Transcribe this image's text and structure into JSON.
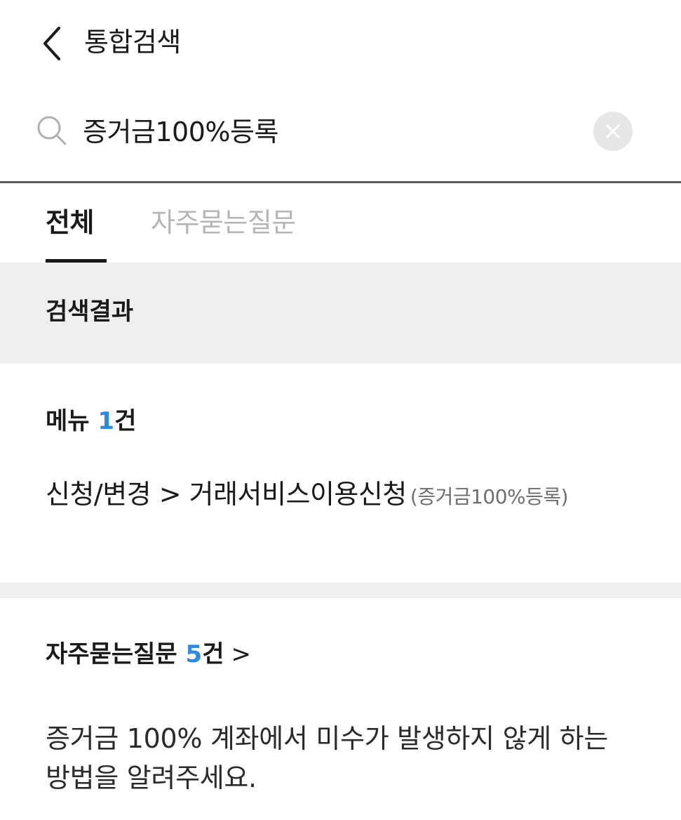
{
  "header": {
    "title": "통합검색"
  },
  "search": {
    "value": "증거금100%등록"
  },
  "tabs": [
    {
      "label": "전체"
    },
    {
      "label": "자주묻는질문"
    }
  ],
  "section_header": {
    "label": "검색결과"
  },
  "menu_section": {
    "title_prefix": "메뉴 ",
    "count": "1",
    "title_suffix": "건",
    "result": {
      "path": "신청/변경 > 거래서비스이용신청",
      "note": "(증거금100%등록)"
    }
  },
  "faq_section": {
    "title_prefix": "자주묻는질문 ",
    "count": "5",
    "title_suffix": "건",
    "arrow": ">",
    "items": [
      {
        "text": "증거금 100% 계좌에서 미수가 발생하지 않게 하는 방법을 알려주세요."
      }
    ]
  },
  "colors": {
    "accent": "#2b8ae6",
    "section_bg": "#efefef",
    "inactive_tab": "#b5b5b5"
  },
  "icons": {
    "back": "chevron-left-icon",
    "search": "search-icon",
    "clear": "clear-icon"
  }
}
